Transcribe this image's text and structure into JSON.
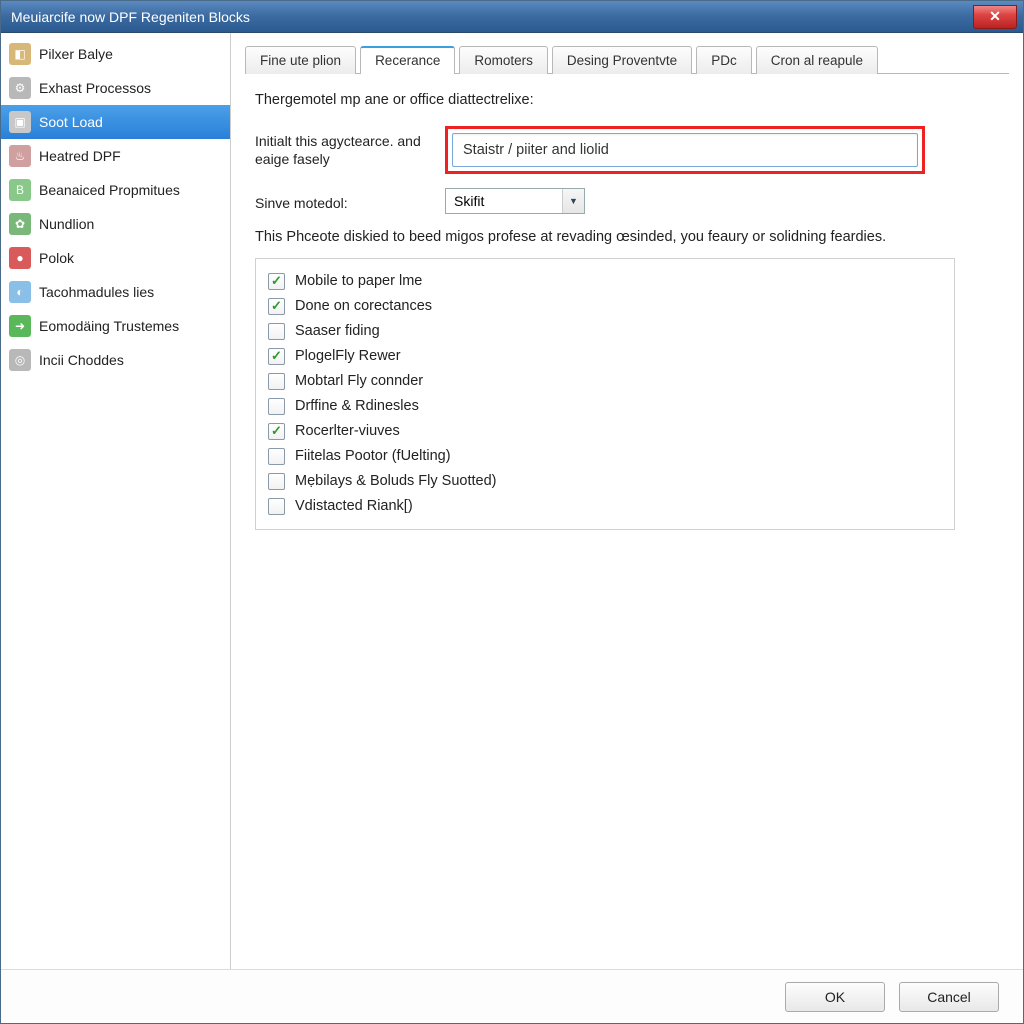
{
  "window": {
    "title": "Meuiarcife now DPF Regeniten Blocks"
  },
  "sidebar": {
    "items": [
      {
        "label": "Pilxer Balye",
        "icon_bg": "#d8b878",
        "glyph": "◧"
      },
      {
        "label": "Exhast Processos",
        "icon_bg": "#b8b8b8",
        "glyph": "⚙"
      },
      {
        "label": "Soot Load",
        "icon_bg": "#c8c8c8",
        "glyph": "▣",
        "selected": true
      },
      {
        "label": "Heatred DPF",
        "icon_bg": "#d0a0a0",
        "glyph": "♨"
      },
      {
        "label": "Beanaiced Propmitues",
        "icon_bg": "#8ac88a",
        "glyph": "B"
      },
      {
        "label": "Nundlion",
        "icon_bg": "#7ab87a",
        "glyph": "✿"
      },
      {
        "label": "Polok",
        "icon_bg": "#d85a5a",
        "glyph": "●"
      },
      {
        "label": "Tacohmadules lies",
        "icon_bg": "#8ac0e8",
        "glyph": "◐"
      },
      {
        "label": "Eomodäing Trustemes",
        "icon_bg": "#5ab85a",
        "glyph": "➜"
      },
      {
        "label": "Incii Choddes",
        "icon_bg": "#b8b8b8",
        "glyph": "◎"
      }
    ]
  },
  "tabs": [
    {
      "label": "Fine ute plion"
    },
    {
      "label": "Recerance",
      "active": true
    },
    {
      "label": "Romoters"
    },
    {
      "label": "Desing Proventvte"
    },
    {
      "label": "PDc"
    },
    {
      "label": "Cron al reapule"
    }
  ],
  "panel": {
    "heading": "Thergemotel mp ane or office diattectrelixe:",
    "label_initial": "Initialt this agyctearce. and eaige fasely",
    "input_value": "Staistr / piiter and liolid",
    "label_sinve": "Sinve motedol:",
    "select_value": "Skifit",
    "desc": "This Phceote diskied to beed migos profese at revading œsinded, you feaury or solidning feardies.",
    "options": [
      {
        "label": "Mobile to paper lme",
        "checked": true
      },
      {
        "label": "Done on corectances",
        "checked": true
      },
      {
        "label": "Saaser fiding",
        "checked": false
      },
      {
        "label": "PlogelFly Rewer",
        "checked": true
      },
      {
        "label": "Mobtarl Fly connder",
        "checked": false
      },
      {
        "label": "Drffine & Rdinesles",
        "checked": false
      },
      {
        "label": "Rocerlter-viuves",
        "checked": true
      },
      {
        "label": "Fiitelas Pootor (fUelting)",
        "checked": false
      },
      {
        "label": "Mẹbilays & Boluds Fly Suotted)",
        "checked": false
      },
      {
        "label": "Vdistacted Riank[)",
        "checked": false
      }
    ]
  },
  "footer": {
    "ok": "OK",
    "cancel": "Cancel"
  }
}
